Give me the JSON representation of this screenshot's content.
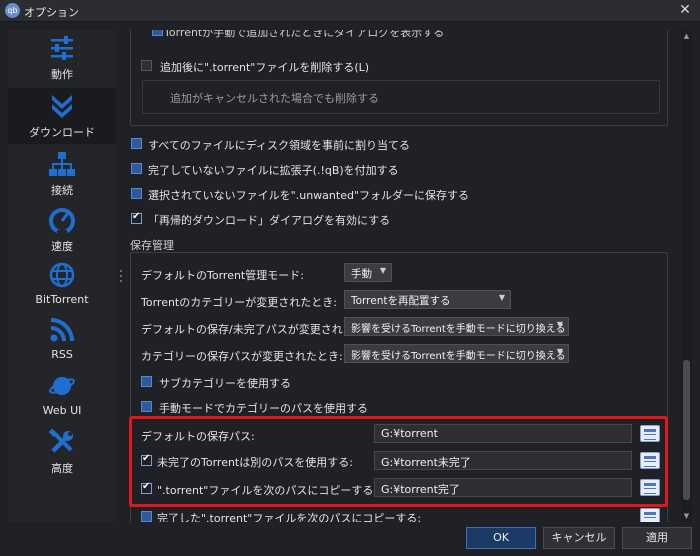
{
  "window": {
    "title": "オプション",
    "app_icon": "qb"
  },
  "sidebar": {
    "items": [
      {
        "label": "動作",
        "icon": "sliders-icon"
      },
      {
        "label": "ダウンロード",
        "icon": "download-chevron-icon",
        "active": true
      },
      {
        "label": "接続",
        "icon": "network-icon"
      },
      {
        "label": "速度",
        "icon": "speedometer-icon"
      },
      {
        "label": "BitTorrent",
        "icon": "globe-icon"
      },
      {
        "label": "RSS",
        "icon": "rss-icon"
      },
      {
        "label": "Web UI",
        "icon": "planet-icon"
      },
      {
        "label": "高度",
        "icon": "tools-icon"
      }
    ]
  },
  "top_group": {
    "cut_line": "Torrentが手動で追加されたときにダイアログを表示する",
    "delete_after_add": "追加後に\".torrent\"ファイルを削除する(L)",
    "delete_sub": "追加がキャンセルされた場合でも削除する"
  },
  "options": [
    {
      "label": "すべてのファイルにディスク領域を事前に割り当てる",
      "checked": false
    },
    {
      "label": "完了していないファイルに拡張子(.!qB)を付加する",
      "checked": false
    },
    {
      "label": "選択されていないファイルを\".unwanted\"フォルダーに保存する",
      "checked": false
    },
    {
      "label": "「再帰的ダウンロード」ダイアログを有効にする",
      "checked": true
    }
  ],
  "save_management": {
    "title": "保存管理",
    "rows": [
      {
        "label": "デフォルトのTorrent管理モード:",
        "value": "手動"
      },
      {
        "label": "Torrentのカテゴリーが変更されたとき:",
        "value": "Torrentを再配置する"
      },
      {
        "label": "デフォルトの保存/未完了パスが変更されたとき:",
        "value": "影響を受けるTorrentを手動モードに切り換える"
      },
      {
        "label": "カテゴリーの保存パスが変更されたとき:",
        "value": "影響を受けるTorrentを手動モードに切り換える"
      }
    ],
    "use_subcategory": "サブカテゴリーを使用する",
    "manual_category_path": "手動モードでカテゴリーのパスを使用する"
  },
  "paths": [
    {
      "label": "デフォルトの保存パス:",
      "value": "G:¥torrent",
      "has_checkbox": false
    },
    {
      "label": "未完了のTorrentは別のパスを使用する:",
      "value": "G:¥torrent未完了",
      "has_checkbox": true,
      "checked": true
    },
    {
      "label": "\".torrent\"ファイルを次のパスにコピーする:",
      "value": "G:¥torrent完了",
      "has_checkbox": true,
      "checked": true
    },
    {
      "label": "完了した\".torrent\"ファイルを次のパスにコピーする:",
      "has_checkbox": true,
      "checked": false
    }
  ],
  "footer": {
    "ok": "OK",
    "cancel": "キャンセル",
    "apply": "適用"
  },
  "colors": {
    "highlight": "#e4161d",
    "accent": "#2c5a9a",
    "icon_blue": "#1f6fd1"
  }
}
